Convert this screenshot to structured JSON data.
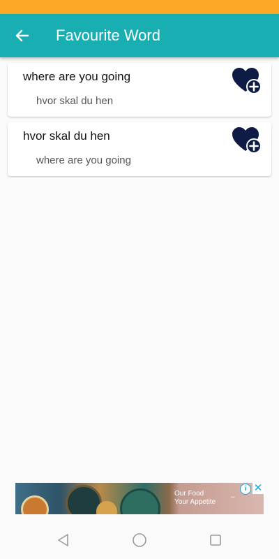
{
  "app_bar": {
    "title": "Favourite Word",
    "back_icon": "arrow-left-icon",
    "background": "#19afb2"
  },
  "status_bar": {
    "color": "#fca927"
  },
  "favourites": [
    {
      "word": "where are you going",
      "translation": "hvor skal du hen",
      "icon": "heart-plus-icon"
    },
    {
      "word": "hvor skal du hen",
      "translation": "where are you going",
      "icon": "heart-plus-icon"
    }
  ],
  "ad": {
    "text_line1": "Our Food",
    "text_line2": "Your Appetite",
    "info_icon": "info-icon",
    "close_icon": "close-icon"
  },
  "nav_bar": {
    "back_icon": "triangle-back-icon",
    "home_icon": "circle-home-icon",
    "recent_icon": "square-recents-icon"
  }
}
